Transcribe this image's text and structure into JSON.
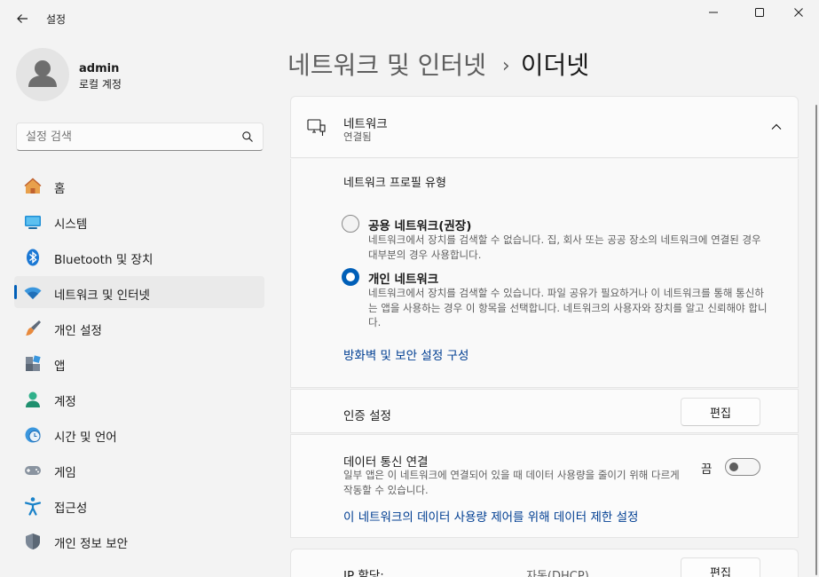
{
  "window": {
    "title": "설정",
    "controls": {
      "minimize": "minimize-icon",
      "maximize": "maximize-icon",
      "close": "close-icon"
    }
  },
  "profile": {
    "name": "admin",
    "account_type": "로컬 계정"
  },
  "search": {
    "placeholder": "설정 검색"
  },
  "sidebar": {
    "items": [
      {
        "label": "홈",
        "icon": "home-icon"
      },
      {
        "label": "시스템",
        "icon": "system-icon"
      },
      {
        "label": "Bluetooth 및 장치",
        "icon": "bluetooth-icon"
      },
      {
        "label": "네트워크 및 인터넷",
        "icon": "wifi-icon",
        "active": true
      },
      {
        "label": "개인 설정",
        "icon": "brush-icon"
      },
      {
        "label": "앱",
        "icon": "apps-icon"
      },
      {
        "label": "계정",
        "icon": "account-icon"
      },
      {
        "label": "시간 및 언어",
        "icon": "clock-globe-icon"
      },
      {
        "label": "게임",
        "icon": "gamepad-icon"
      },
      {
        "label": "접근성",
        "icon": "accessibility-icon"
      },
      {
        "label": "개인 정보 보안",
        "icon": "shield-icon"
      }
    ]
  },
  "header": {
    "parent": "네트워크 및 인터넷",
    "separator": "›",
    "current": "이더넷"
  },
  "network_card": {
    "title": "네트워크",
    "status": "연결됨"
  },
  "profile_type": {
    "label": "네트워크 프로필 유형",
    "options": [
      {
        "title": "공용 네트워크(권장)",
        "description": "네트워크에서 장치를 검색할 수 없습니다. 집, 회사 또는 공공 장소의 네트워크에 연결된 경우 대부분의 경우 사용합니다.",
        "selected": false
      },
      {
        "title": "개인 네트워크",
        "description": "네트워크에서 장치를 검색할 수 있습니다. 파일 공유가 필요하거나 이 네트워크를 통해 통신하는 앱을 사용하는 경우 이 항목을 선택합니다. 네트워크의 사용자와 장치를 알고 신뢰해야 합니다.",
        "selected": true
      }
    ],
    "firewall_link": "방화벽 및 보안 설정 구성"
  },
  "auth": {
    "label": "인증 설정",
    "button": "편집"
  },
  "metered": {
    "label": "데이터 통신 연결",
    "description": "일부 앱은 이 네트워크에 연결되어 있을 때 데이터 사용량을 줄이기 위해 다르게 작동할 수 있습니다.",
    "state_text": "끔",
    "enabled": false,
    "limit_link": "이 네트워크의 데이터 사용량 제어를 위해 데이터 제한 설정"
  },
  "ip": {
    "label": "IP 할당:",
    "value": "자동(DHCP)",
    "button": "편집"
  },
  "colors": {
    "accent": "#005fb8",
    "link": "#003e92",
    "background": "#f3f3f3"
  }
}
